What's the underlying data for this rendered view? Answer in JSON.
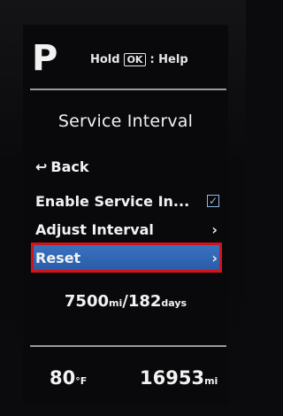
{
  "header": {
    "gear": "P",
    "hint_prefix": "Hold",
    "hint_key": "OK",
    "hint_suffix": ": Help"
  },
  "title": "Service Interval",
  "menu": {
    "back_icon": "↩",
    "back_label": "Back",
    "items": [
      {
        "label": "Enable Service In...",
        "icon": "checkbox-checked-icon",
        "checked": true
      },
      {
        "label": "Adjust Interval",
        "icon": "chevron-right-icon"
      },
      {
        "label": "Reset",
        "icon": "chevron-right-icon",
        "selected": true
      }
    ],
    "chevron": "›",
    "check": "✓"
  },
  "interval": {
    "distance": "7500",
    "distance_unit": "mi",
    "separator": "/",
    "time": "182",
    "time_unit": "days"
  },
  "status": {
    "temperature": "80",
    "temperature_unit": "°F",
    "odometer": "16953",
    "odometer_unit": "mi"
  },
  "colors": {
    "selection": "#2f66b3",
    "highlight_border": "#d3131a",
    "checkbox": "#8fb8e8"
  }
}
